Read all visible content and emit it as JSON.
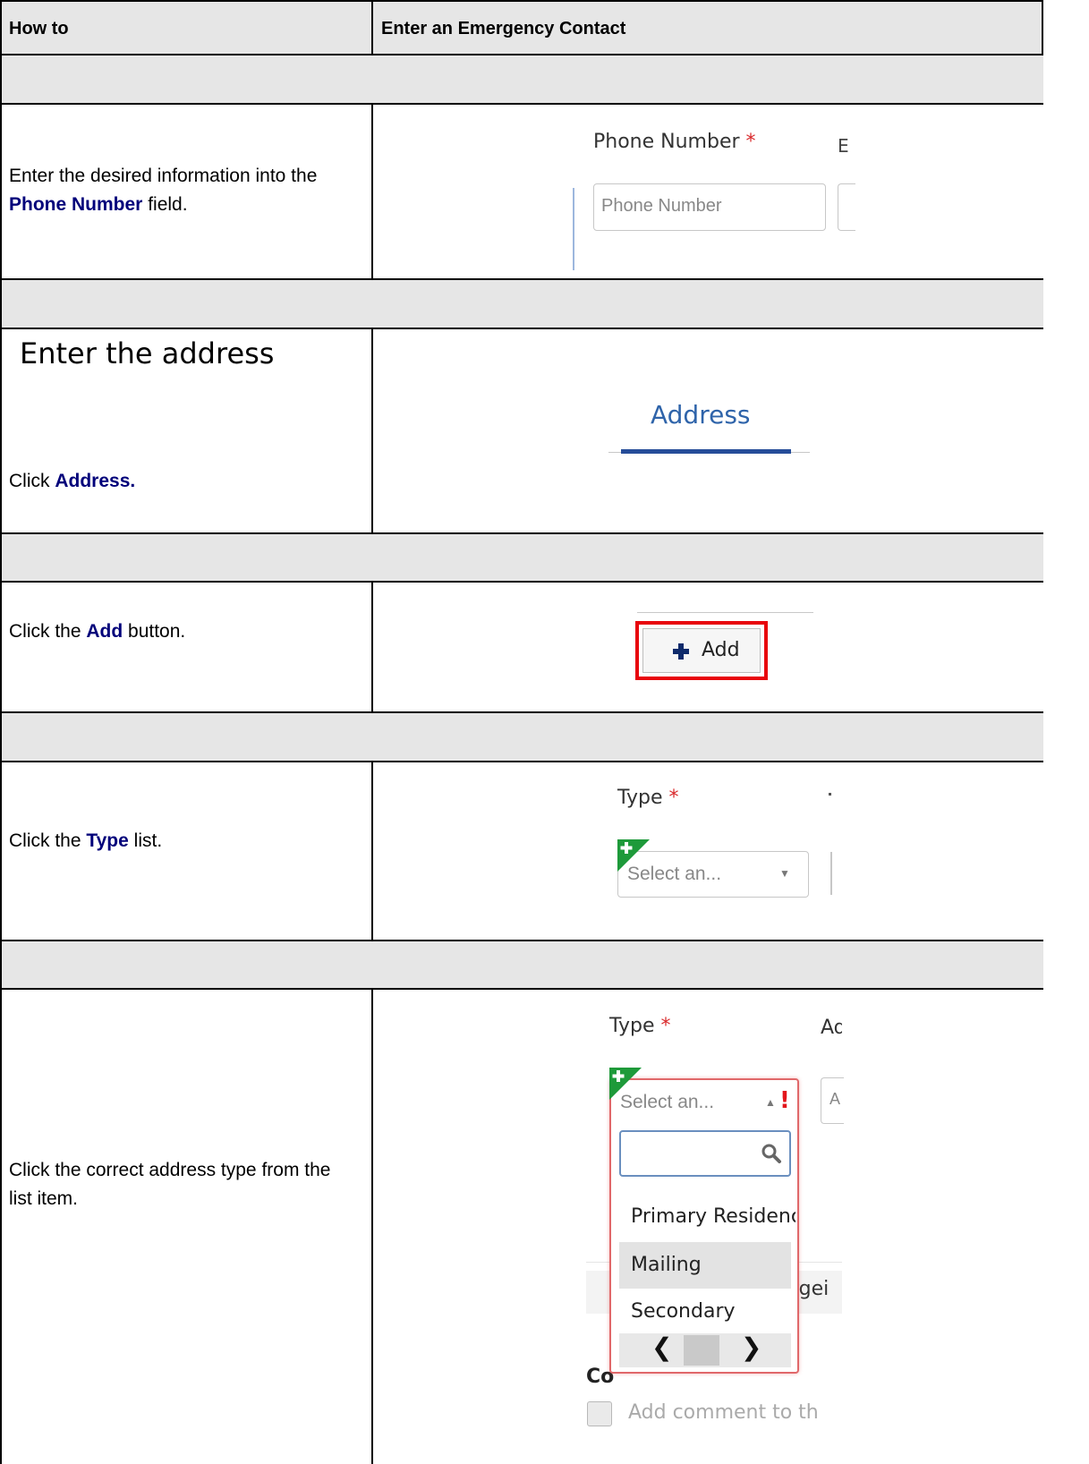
{
  "header": {
    "left": "How to",
    "right": "Enter an Emergency Contact"
  },
  "steps": {
    "phone": {
      "instr_pre": "Enter the desired information into the ",
      "instr_kw": "Phone Number",
      "instr_post": " field.",
      "ui_label": "Phone Number",
      "ui_required": "*",
      "ui_placeholder": "Phone Number",
      "ui_fragment": "E"
    },
    "address": {
      "heading": "Enter the address",
      "instr_pre": "Click ",
      "instr_kw": "Address.",
      "ui_tab": "Address"
    },
    "add": {
      "instr_pre": "Click the ",
      "instr_kw": "Add",
      "instr_post": " button.",
      "ui_button": "Add",
      "ui_button_icon": "plus-icon"
    },
    "type_list": {
      "instr_pre": "Click the ",
      "instr_kw": "Type",
      "instr_post": " list.",
      "ui_label": "Type",
      "ui_required": "*",
      "ui_select_text": "Select an..."
    },
    "type_select": {
      "instr": "Click the correct address type from the list item.",
      "ui_label": "Type",
      "ui_required": "*",
      "ui_fragment_label": "Ad",
      "ui_select_text": "Select an...",
      "ui_fragment_input": "A",
      "options": [
        "Primary Residenc",
        "Mailing",
        "Secondary"
      ],
      "behind_fragment": "rgei",
      "behind_heading": "Co",
      "behind_checkbox_text": "Add comment to th"
    }
  },
  "colors": {
    "keyword": "#00007a",
    "row_gray": "#e6e6e6",
    "required": "#d9292b",
    "highlight_frame": "#e8050c",
    "tab_blue": "#2f64aa"
  }
}
